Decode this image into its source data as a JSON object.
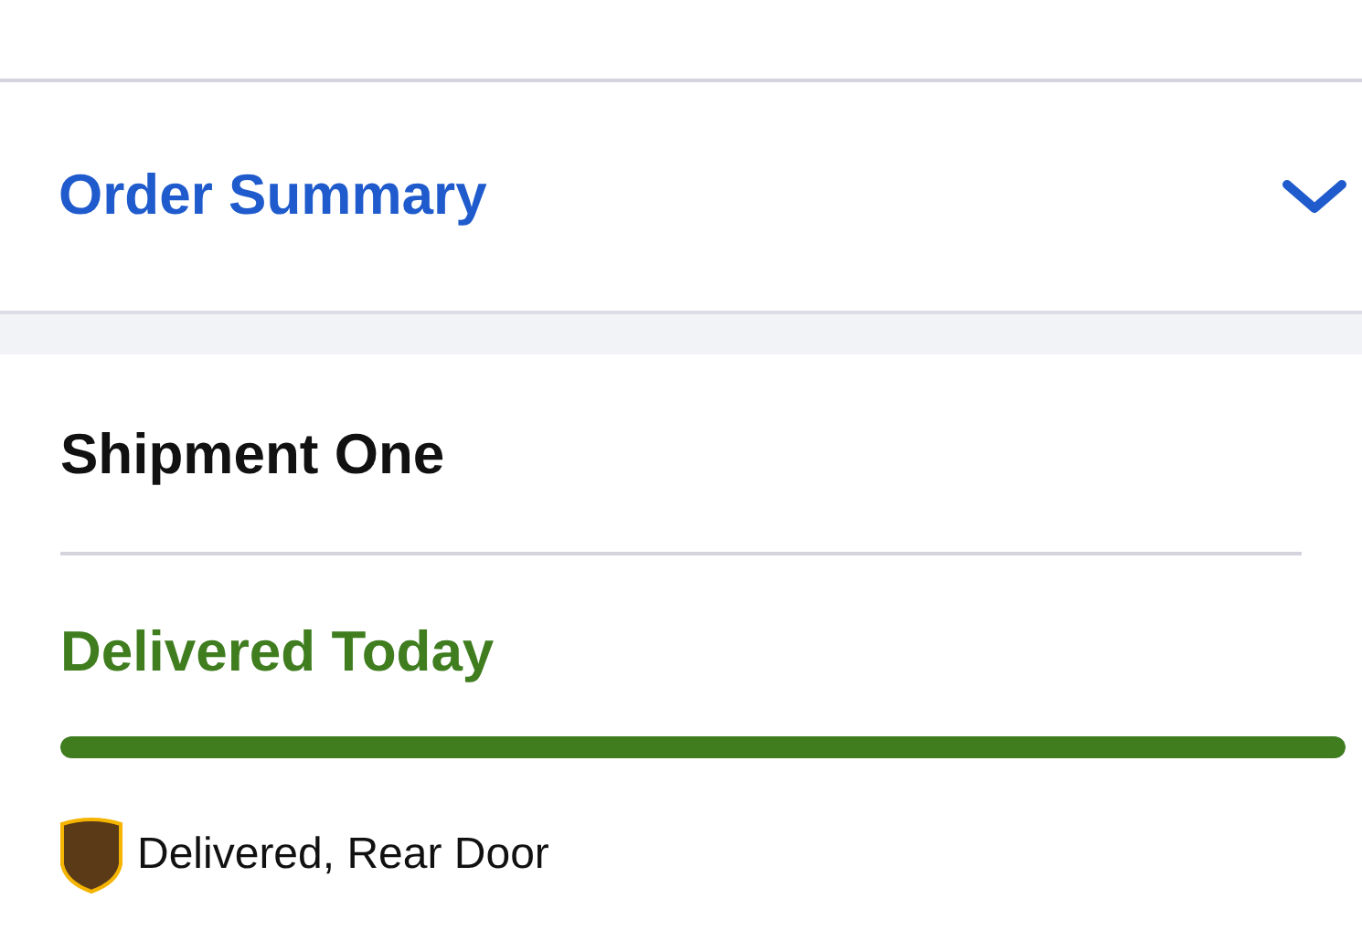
{
  "order_summary": {
    "title": "Order Summary",
    "expanded": false
  },
  "shipment": {
    "title": "Shipment One",
    "status": "Delivered Today",
    "progress": {
      "level": 1
    },
    "carrier_status": "Delivered, Rear Door"
  }
}
